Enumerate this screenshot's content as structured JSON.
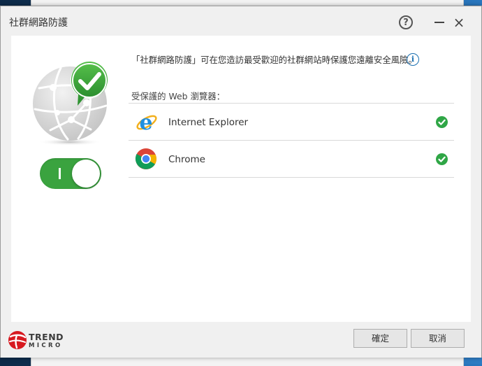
{
  "window": {
    "title": "社群網路防護",
    "help_glyph": "?",
    "close_glyph": "×"
  },
  "protection": {
    "enabled": true,
    "description": "「社群網路防護」可在您造訪最受歡迎的社群網站時保護您遠離安全風險。",
    "info_glyph": "i"
  },
  "browsers": {
    "label": "受保護的 Web 瀏覽器：",
    "items": [
      {
        "name": "Internet Explorer",
        "icon": "internet-explorer-icon",
        "protected": true
      },
      {
        "name": "Chrome",
        "icon": "chrome-icon",
        "protected": true
      }
    ]
  },
  "footer": {
    "brand_line1": "TREND",
    "brand_line2": "MICRO",
    "ok_label": "確定",
    "cancel_label": "取消"
  },
  "colors": {
    "toggle_on": "#3aa33f",
    "check_green": "#2fa646",
    "brand_red": "#d71920",
    "info_blue": "#1a6fb0"
  }
}
